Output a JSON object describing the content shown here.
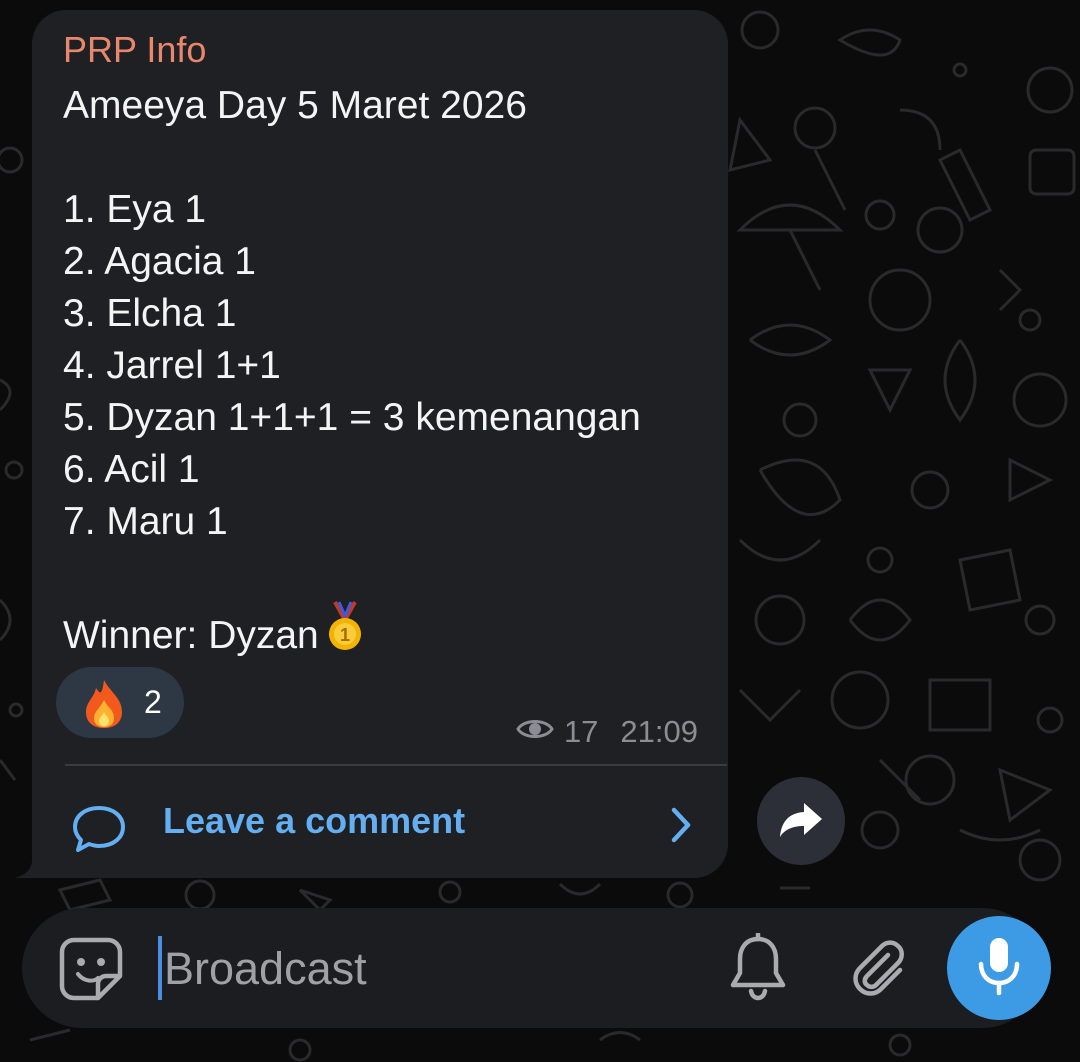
{
  "message": {
    "sender": "PRP Info",
    "lines": [
      "Ameeya Day 5 Maret 2026",
      "",
      "1. Eya 1",
      "2. Agacia 1",
      "3. Elcha 1",
      "4. Jarrel 1+1",
      "5. Dyzan 1+1+1 = 3 kemenangan",
      "6. Acil 1",
      "7. Maru 1",
      "",
      "Winner: Dyzan"
    ],
    "winner_icon": "first-place-medal-icon",
    "reaction": {
      "icon": "fire-icon",
      "count": "2"
    },
    "views": "17",
    "time": "21:09",
    "comment_label": "Leave a comment"
  },
  "input": {
    "placeholder": "Broadcast"
  },
  "icons": {
    "share": "share-arrow-icon",
    "emoji": "sticker-icon",
    "bell": "bell-icon",
    "attach": "paperclip-icon",
    "mic": "microphone-icon"
  },
  "colors": {
    "background": "#0b0b0c",
    "bubble": "#1f2023",
    "sender": "#e8876e",
    "link": "#64aef2",
    "reaction_bg": "#2e3744",
    "mic_button": "#3d9be6"
  }
}
